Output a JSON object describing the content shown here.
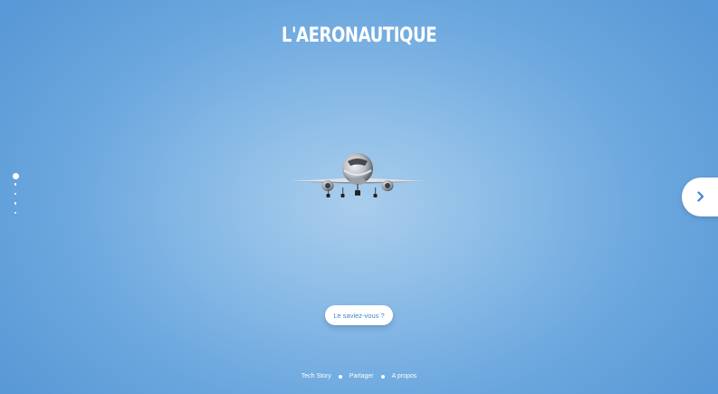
{
  "header": {
    "title": "L'AERONAUTIQUE"
  },
  "slider": {
    "total_slides": 5,
    "active_index": 0,
    "next_icon": "chevron-right-icon"
  },
  "hero": {
    "image": "airplane-front-view"
  },
  "cta": {
    "label": "Le saviez-vous ?"
  },
  "footer": {
    "links": [
      {
        "label": "Tech Story"
      },
      {
        "label": "Partager"
      },
      {
        "label": "A propos"
      }
    ]
  },
  "colors": {
    "background": "#6ea9df",
    "accent": "#3d86cf",
    "white": "#ffffff"
  }
}
